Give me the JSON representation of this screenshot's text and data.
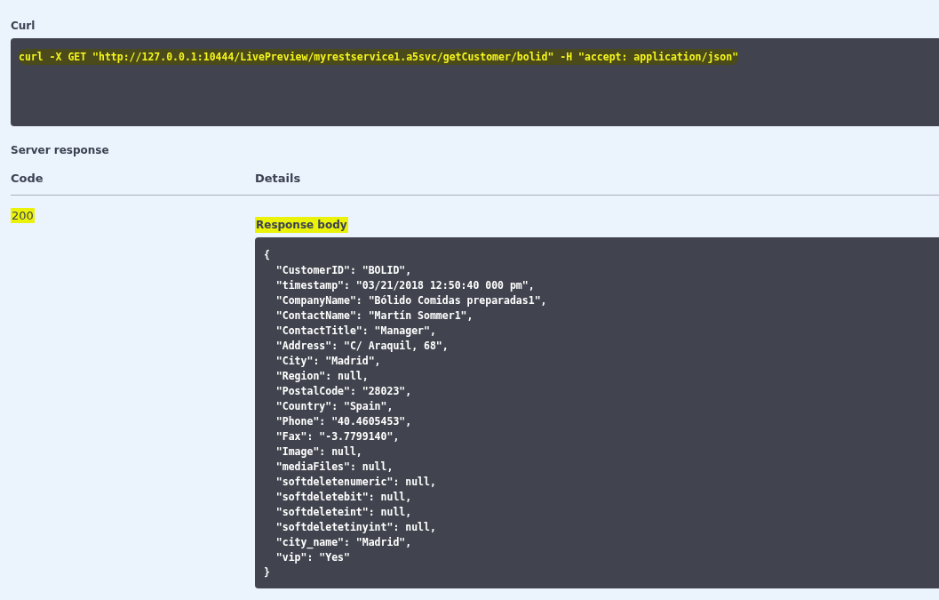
{
  "curl": {
    "label": "Curl",
    "command": "curl -X GET \"http://127.0.0.1:10444/LivePreview/myrestservice1.a5svc/getCustomer/bolid\" -H \"accept: application/json\"",
    "highlighted": true
  },
  "server_response": {
    "title": "Server response",
    "columns": [
      "Code",
      "Details"
    ],
    "code": {
      "text": "200",
      "highlighted": true
    },
    "response_body": {
      "label": "Response body",
      "highlighted": true,
      "lines": [
        "{",
        "  \"CustomerID\": \"BOLID\",",
        "  \"timestamp\": \"03/21/2018 12:50:40 000 pm\",",
        "  \"CompanyName\": \"Bólido Comidas preparadas1\",",
        "  \"ContactName\": \"Martín Sommer1\",",
        "  \"ContactTitle\": \"Manager\",",
        "  \"Address\": \"C/ Araquil, 68\",",
        "  \"City\": \"Madrid\",",
        "  \"Region\": null,",
        "  \"PostalCode\": \"28023\",",
        "  \"Country\": \"Spain\",",
        "  \"Phone\": \"40.4605453\",",
        "  \"Fax\": \"-3.7799140\",",
        "  \"Image\": null,",
        "  \"mediaFiles\": null,",
        "  \"softdeletenumeric\": null,",
        "  \"softdeletebit\": null,",
        "  \"softdeleteint\": null,",
        "  \"softdeletetinyint\": null,",
        "  \"city_name\": \"Madrid\",",
        "  \"vip\": \"Yes\"",
        "}"
      ]
    }
  }
}
